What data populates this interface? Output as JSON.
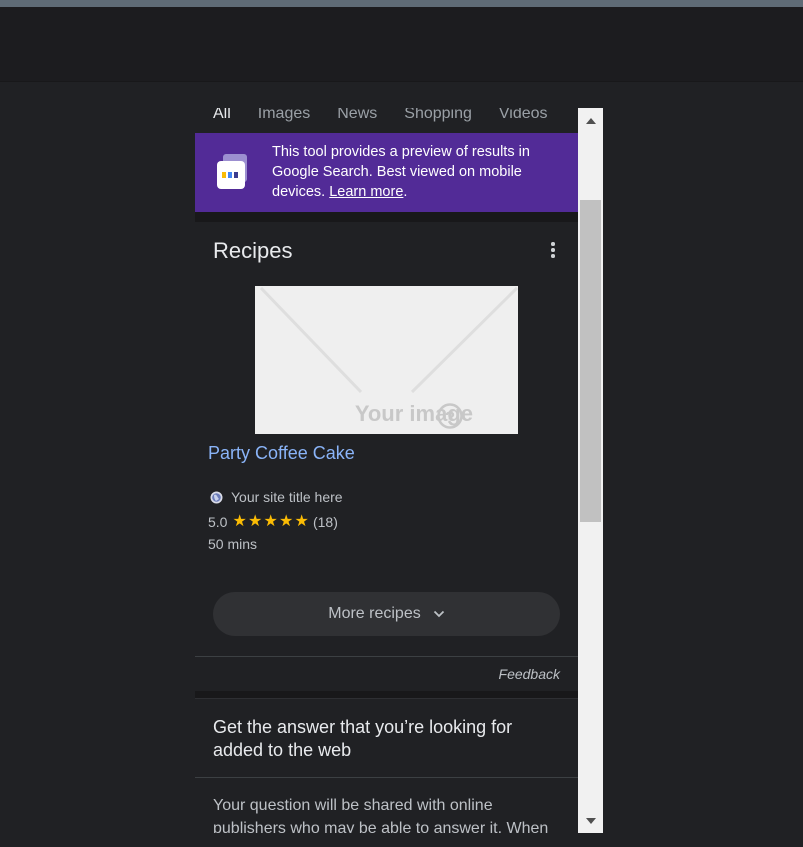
{
  "tabs": [
    "All",
    "Images",
    "News",
    "Shopping",
    "Videos"
  ],
  "banner": {
    "text": "This tool provides a preview of results in Google Search. Best viewed on mobile devices.",
    "link": "Learn more",
    "period": "."
  },
  "recipes": {
    "heading": "Recipes",
    "image_placeholder": "Your image",
    "recipe_title": "Party Coffee Cake",
    "site_title": "Your site title here",
    "rating": "5.0",
    "star_count": 5,
    "review_count": "(18)",
    "time": "50 mins",
    "more_label": "More recipes"
  },
  "feedback": "Feedback",
  "qa": {
    "title": "Get the answer that you’re looking for added to the web",
    "body": "Your question will be shared with online publishers who may be able to answer it. When"
  },
  "colors": {
    "banner_bg": "#522b97",
    "link": "#8ab4f8",
    "star": "#fbbc04",
    "page_bg": "#202124"
  }
}
